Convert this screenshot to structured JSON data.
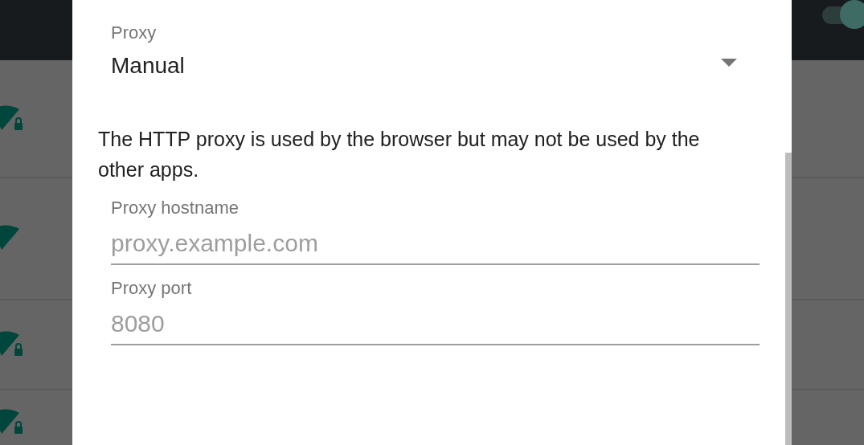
{
  "wifi_switch": {
    "on": true
  },
  "networks": [
    {
      "locked": true
    },
    {
      "locked": false
    },
    {
      "locked": true
    },
    {
      "locked": true
    }
  ],
  "dialog": {
    "proxy": {
      "label": "Proxy",
      "value": "Manual"
    },
    "note": "The HTTP proxy is used by the browser but may not be used by the other apps.",
    "fields": [
      {
        "label": "Proxy hostname",
        "placeholder": "proxy.example.com"
      },
      {
        "label": "Proxy port",
        "placeholder": "8080"
      }
    ]
  }
}
